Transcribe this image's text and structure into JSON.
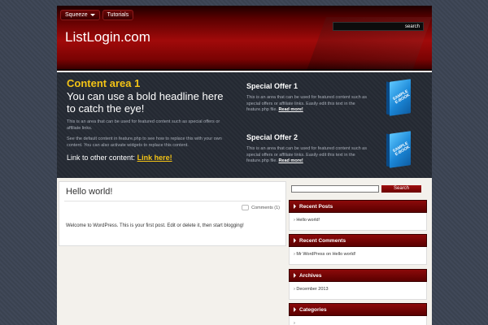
{
  "nav": {
    "items": [
      {
        "label": "Squeeze",
        "dropdown": true
      },
      {
        "label": "Tutorials",
        "dropdown": false
      }
    ]
  },
  "header": {
    "site_title": "ListLogin.com",
    "search_label": "search"
  },
  "feature": {
    "title": "Content area 1",
    "headline": "You can use a bold headline here to catch the eye!",
    "text1": "This is an area that can be used for featured content such as special offers or affiliate links.",
    "text2": "See the default content in feature.php to see how to replace this with your own content. You can also activate widgets to replace this content.",
    "link_prefix": "Link to other content:",
    "link_label": "Link here!"
  },
  "offers": [
    {
      "title": "Special Offer 1",
      "text": "This is an area that can be used for featured content such as special offers or affiliate links. Easily edit this text in the feature.php file.",
      "more": "Read more!",
      "ebook": "SAMPLE E-BOOK"
    },
    {
      "title": "Special Offer 2",
      "text": "This is an area that can be used for featured content such as special offers or affiliate links. Easily edit this text in the feature.php file.",
      "more": "Read more!",
      "ebook": "SAMPLE E-BOOK"
    }
  ],
  "post": {
    "title": "Hello world!",
    "comments": "Comments (1)",
    "body": "Welcome to WordPress. This is your first post. Edit or delete it, then start blogging!"
  },
  "sidebar": {
    "search_button": "Search",
    "widgets": [
      {
        "title": "Recent Posts",
        "item": "Hello world!"
      },
      {
        "title": "Recent Comments",
        "item": "Mr WordPress on Hello world!"
      },
      {
        "title": "Archives",
        "item": "December 2013"
      },
      {
        "title": "Categories",
        "item": ""
      }
    ]
  },
  "colors": {
    "accent": "#8c0a0a",
    "headline_yellow": "#f3c316",
    "feature_bg": "#252a33"
  }
}
